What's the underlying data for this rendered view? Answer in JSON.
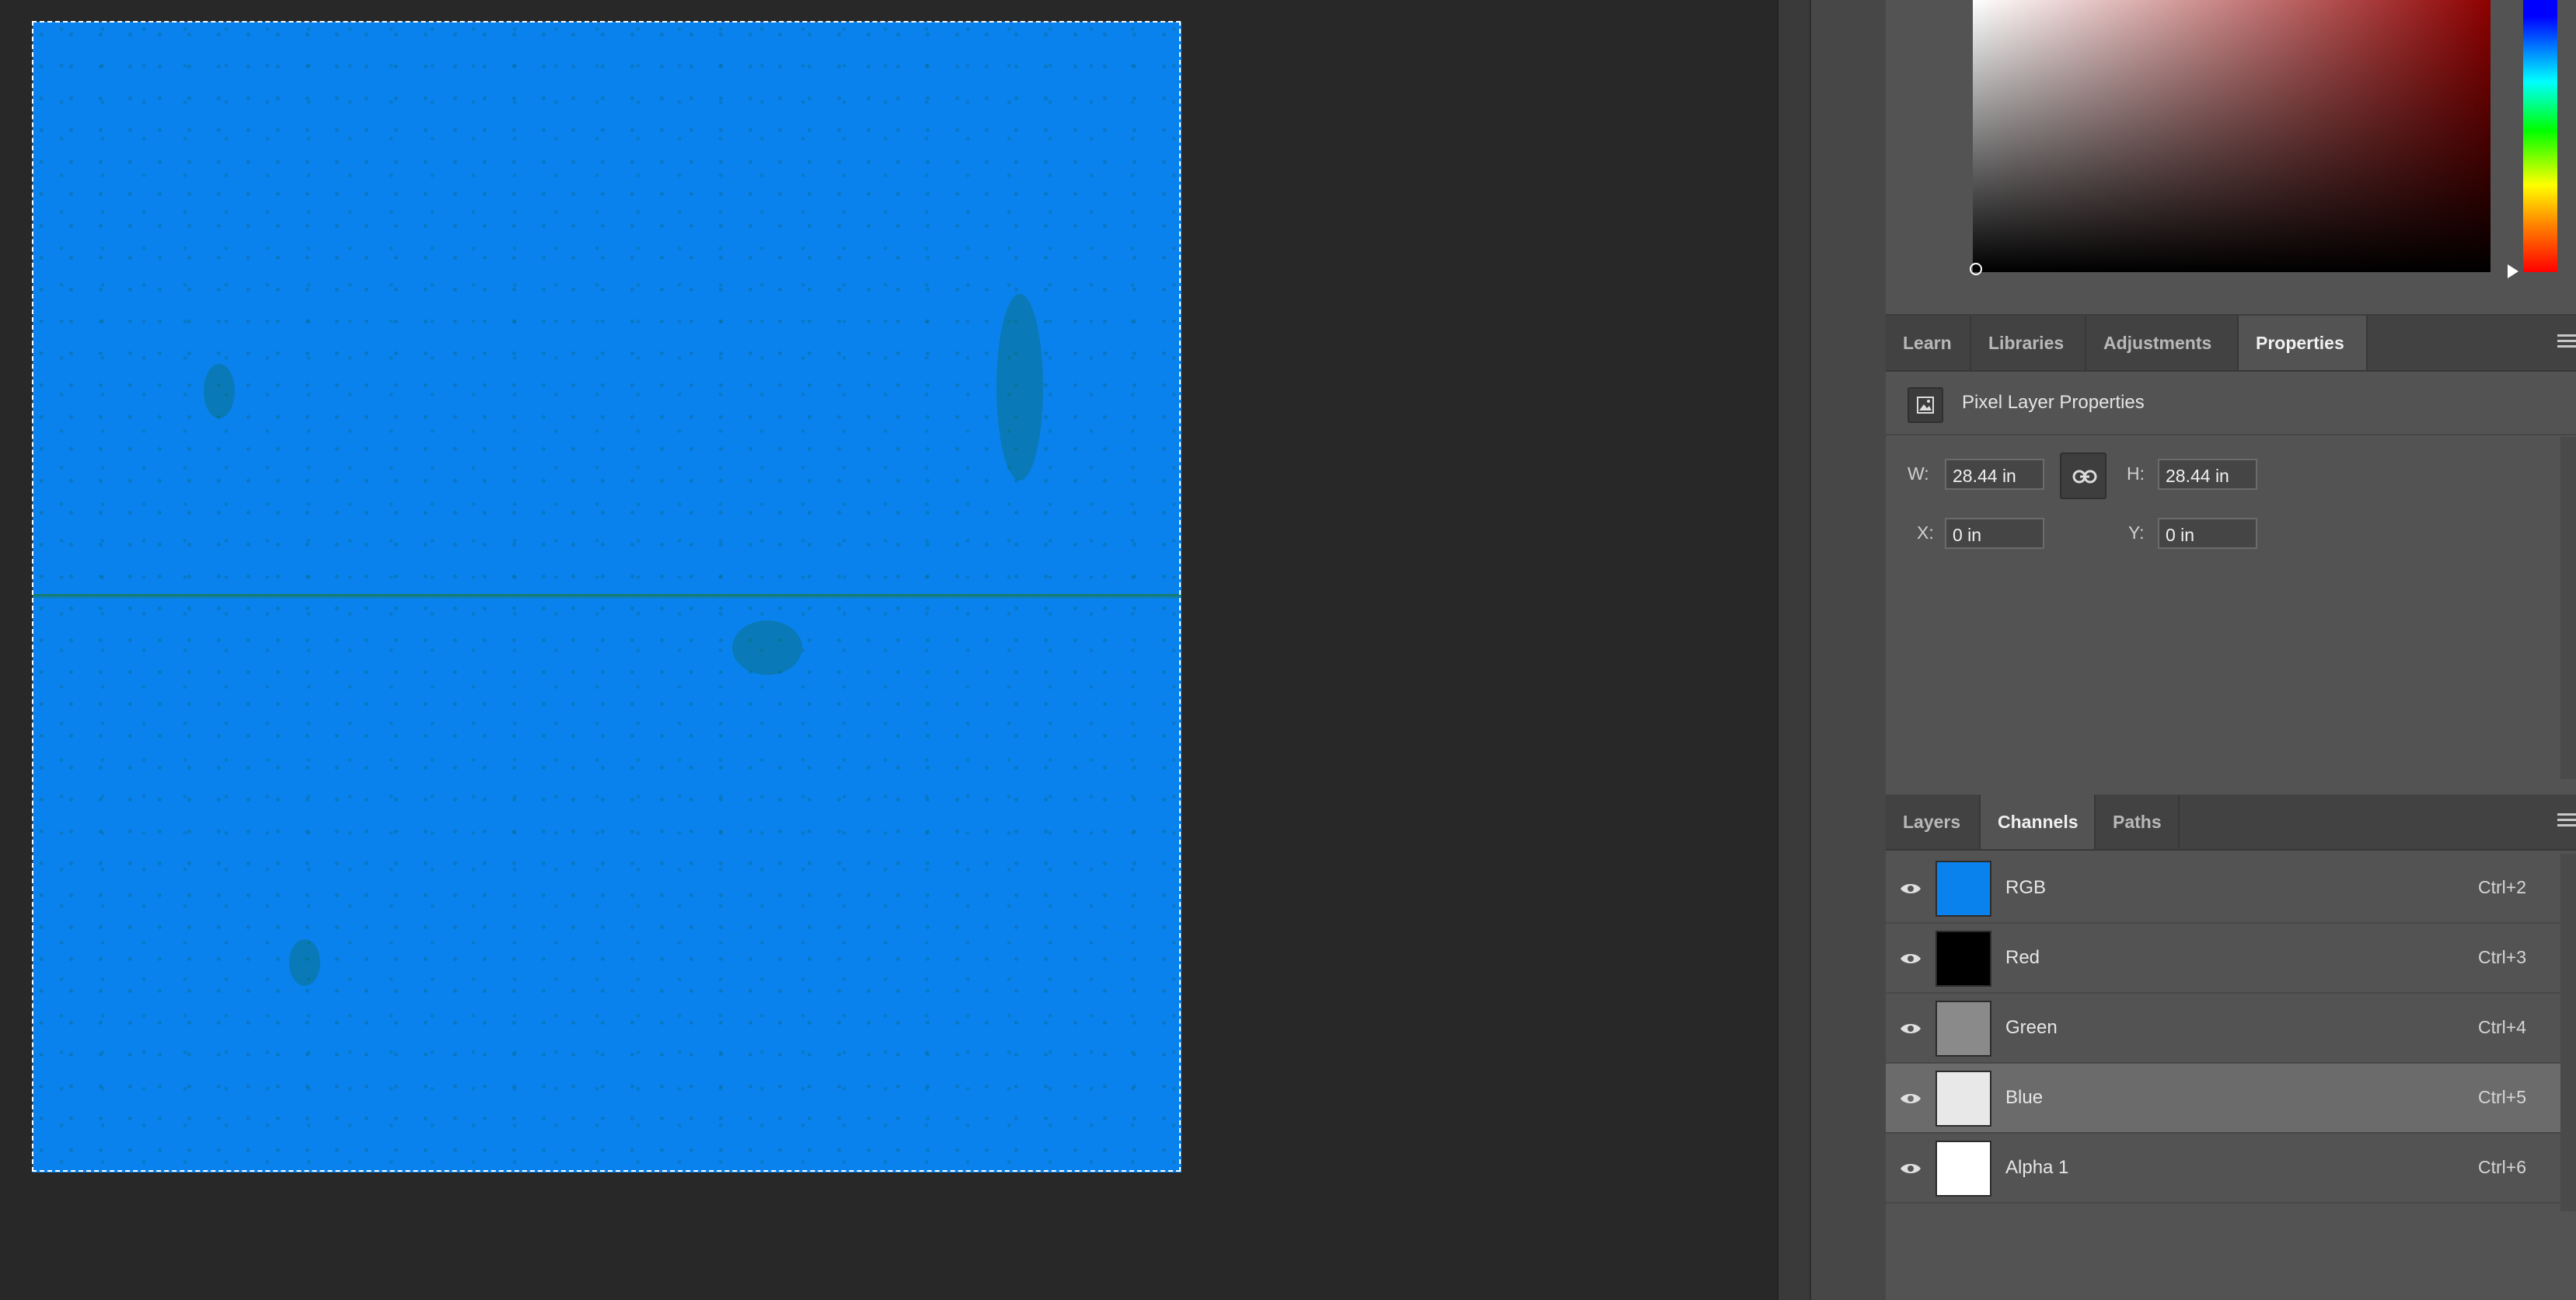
{
  "canvas": {
    "image_color": "#0a82ee",
    "marquee_color": "#ffffff"
  },
  "color_picker": {
    "hue_color": "#8e0000"
  },
  "properties_panel": {
    "tabs": [
      {
        "label": "Learn",
        "active": false
      },
      {
        "label": "Libraries",
        "active": false
      },
      {
        "label": "Adjustments",
        "active": false
      },
      {
        "label": "Properties",
        "active": true
      }
    ],
    "title": "Pixel Layer Properties",
    "w_label": "W:",
    "w_value": "28.44 in",
    "h_label": "H:",
    "h_value": "28.44 in",
    "x_label": "X:",
    "x_value": "0 in",
    "y_label": "Y:",
    "y_value": "0 in"
  },
  "channels_panel": {
    "tabs": [
      {
        "label": "Layers",
        "active": false
      },
      {
        "label": "Channels",
        "active": true
      },
      {
        "label": "Paths",
        "active": false
      }
    ],
    "channels": [
      {
        "name": "RGB",
        "shortcut": "Ctrl+2",
        "thumb": "#0a82ee",
        "selected": false
      },
      {
        "name": "Red",
        "shortcut": "Ctrl+3",
        "thumb": "#000000",
        "selected": false
      },
      {
        "name": "Green",
        "shortcut": "Ctrl+4",
        "thumb": "#8a8a8a",
        "selected": false
      },
      {
        "name": "Blue",
        "shortcut": "Ctrl+5",
        "thumb": "#e8e8e8",
        "selected": true
      },
      {
        "name": "Alpha 1",
        "shortcut": "Ctrl+6",
        "thumb": "#ffffff",
        "selected": false
      }
    ]
  }
}
